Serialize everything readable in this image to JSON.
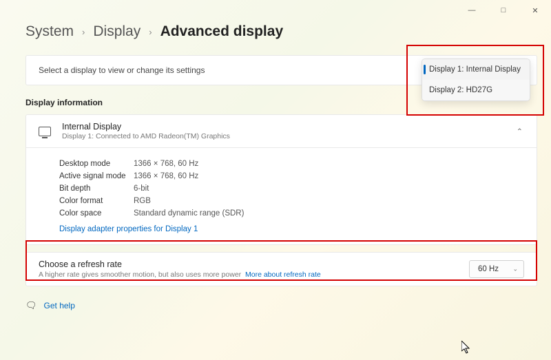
{
  "windowControls": {
    "minimize": "—",
    "maximize": "□",
    "close": "✕"
  },
  "breadcrumb": {
    "item1": "System",
    "item2": "Display",
    "current": "Advanced display"
  },
  "selectPrompt": "Select a display to view or change its settings",
  "dropdown": {
    "items": [
      "Display 1: Internal Display",
      "Display 2: HD27G"
    ]
  },
  "sectionTitle": "Display information",
  "displayHeader": {
    "title": "Internal Display",
    "subtitle": "Display 1: Connected to AMD Radeon(TM) Graphics"
  },
  "details": {
    "desktopMode": {
      "label": "Desktop mode",
      "value": "1366 × 768, 60 Hz"
    },
    "activeSignal": {
      "label": "Active signal mode",
      "value": "1366 × 768, 60 Hz"
    },
    "bitDepth": {
      "label": "Bit depth",
      "value": "6-bit"
    },
    "colorFormat": {
      "label": "Color format",
      "value": "RGB"
    },
    "colorSpace": {
      "label": "Color space",
      "value": "Standard dynamic range (SDR)"
    }
  },
  "adapterLink": "Display adapter properties for Display 1",
  "refresh": {
    "title": "Choose a refresh rate",
    "subtitle": "A higher rate gives smoother motion, but also uses more power",
    "moreLink": "More about refresh rate",
    "selected": "60 Hz"
  },
  "getHelp": "Get help"
}
